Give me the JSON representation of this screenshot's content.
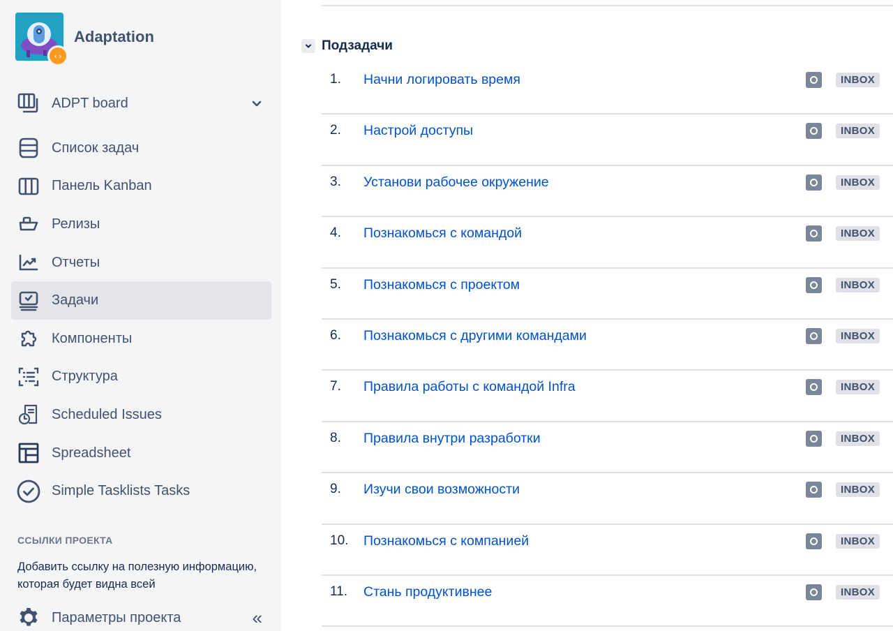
{
  "project": {
    "name": "Adaptation",
    "avatar_icon": "ufo-robot-icon",
    "badge_icon": "code-brackets-icon",
    "badge_glyph": "‹›"
  },
  "board_selector": {
    "label": "ADPT board",
    "icon": "board-icon",
    "chevron": "chevron-down-icon"
  },
  "sidebar": {
    "items": [
      {
        "label": "Список задач",
        "icon": "backlog-icon",
        "active": false
      },
      {
        "label": "Панель Kanban",
        "icon": "kanban-board-icon",
        "active": false
      },
      {
        "label": "Релизы",
        "icon": "ship-icon",
        "active": false
      },
      {
        "label": "Отчеты",
        "icon": "chart-icon",
        "active": false
      },
      {
        "label": "Задачи",
        "icon": "issues-icon",
        "active": true
      },
      {
        "label": "Компоненты",
        "icon": "puzzle-icon",
        "active": false
      },
      {
        "label": "Структура",
        "icon": "structure-icon",
        "active": false
      },
      {
        "label": "Scheduled Issues",
        "icon": "scheduled-icon",
        "active": false
      },
      {
        "label": "Spreadsheet",
        "icon": "spreadsheet-icon",
        "active": false
      },
      {
        "label": "Simple Tasklists Tasks",
        "icon": "check-circle-icon",
        "active": false
      }
    ],
    "links_heading": "ССЫЛКИ ПРОЕКТА",
    "links_text": "Добавить ссылку на полезную информацию, которая будет видна всей",
    "settings_label": "Параметры проекта",
    "collapse_glyph": "«"
  },
  "main": {
    "section_title": "Подзадачи",
    "subtasks": [
      {
        "num": "1.",
        "title": "Начни логировать время",
        "status": "INBOX"
      },
      {
        "num": "2.",
        "title": "Настрой доступы",
        "status": "INBOX"
      },
      {
        "num": "3.",
        "title": "Установи рабочее окружение",
        "status": "INBOX"
      },
      {
        "num": "4.",
        "title": "Познакомься с командой",
        "status": "INBOX"
      },
      {
        "num": "5.",
        "title": "Познакомься с проектом",
        "status": "INBOX"
      },
      {
        "num": "6.",
        "title": "Познакомься с другими командами",
        "status": "INBOX"
      },
      {
        "num": "7.",
        "title": "Правила работы с командой Infra",
        "status": "INBOX"
      },
      {
        "num": "8.",
        "title": "Правила внутри разработки",
        "status": "INBOX"
      },
      {
        "num": "9.",
        "title": "Изучи свои возможности",
        "status": "INBOX"
      },
      {
        "num": "10.",
        "title": "Познакомься с компанией",
        "status": "INBOX"
      },
      {
        "num": "11.",
        "title": "Стань продуктивнее",
        "status": "INBOX"
      }
    ]
  },
  "colors": {
    "sidebar_bg": "#f4f5f7",
    "active_item_bg": "#e3e5ea",
    "link": "#0052cc",
    "text": "#42526e",
    "status_icon": "#7a869a",
    "badge_bg": "#dfe1e6",
    "avatar_bg": "#1fa2c4",
    "avatar_badge": "#ff991f"
  }
}
